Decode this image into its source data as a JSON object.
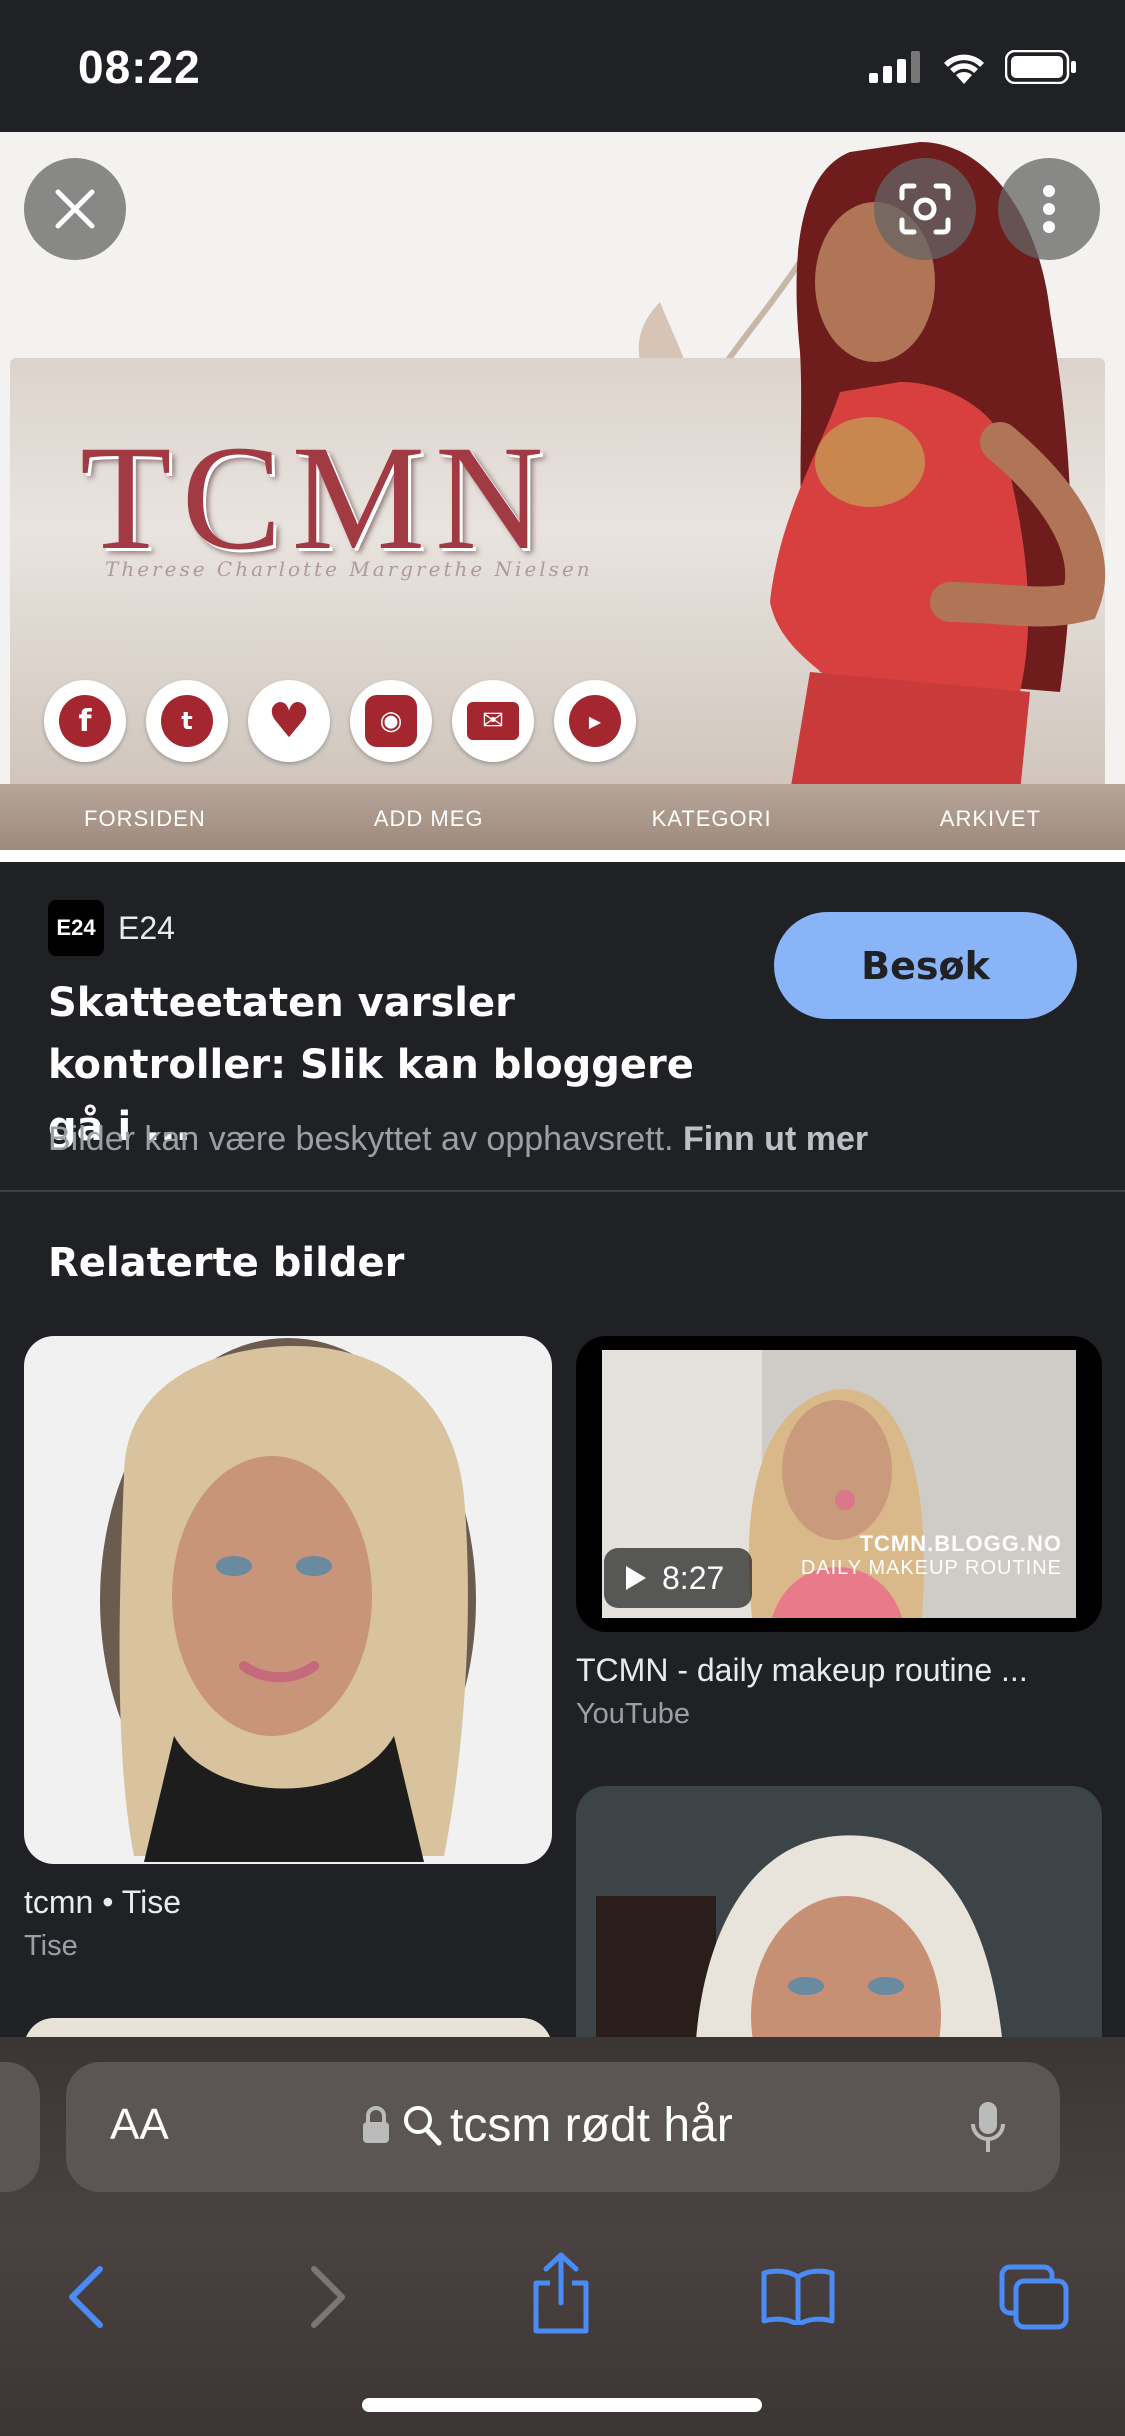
{
  "status_bar": {
    "time": "08:22"
  },
  "hero": {
    "title": "TCMN",
    "subtitle": "Therese Charlotte Margrethe Nielsen",
    "nav_items": [
      "FORSIDEN",
      "ADD MEG",
      "KATEGORI",
      "ARKIVET"
    ],
    "social_icons": [
      "facebook-icon",
      "twitter-icon",
      "heart-icon",
      "instagram-icon",
      "mail-icon",
      "youtube-icon"
    ]
  },
  "result": {
    "source_logo": "E24",
    "source_name": "E24",
    "headline": "Skatteetaten varsler kontroller: Slik kan bloggere gå i ...",
    "visit_label": "Besøk",
    "copyright_text": "Bilder kan være beskyttet av opphavsrett.",
    "learn_more": "Finn ut mer"
  },
  "related": {
    "title": "Relaterte bilder",
    "items": [
      {
        "title": "tcmn • Tise",
        "source": "Tise"
      },
      {
        "title": "TCMN - daily makeup routine ...",
        "source": "YouTube",
        "duration": "8:27",
        "overlay_line1": "TCMN.BLOGG.NO",
        "overlay_line2": "DAILY MAKEUP ROUTINE"
      }
    ]
  },
  "browser": {
    "text_size_label": "AA",
    "search_query": "tcsm rødt hår"
  },
  "colors": {
    "accent": "#8ab4f8",
    "background": "#202124",
    "brand_red": "#a13a43"
  }
}
